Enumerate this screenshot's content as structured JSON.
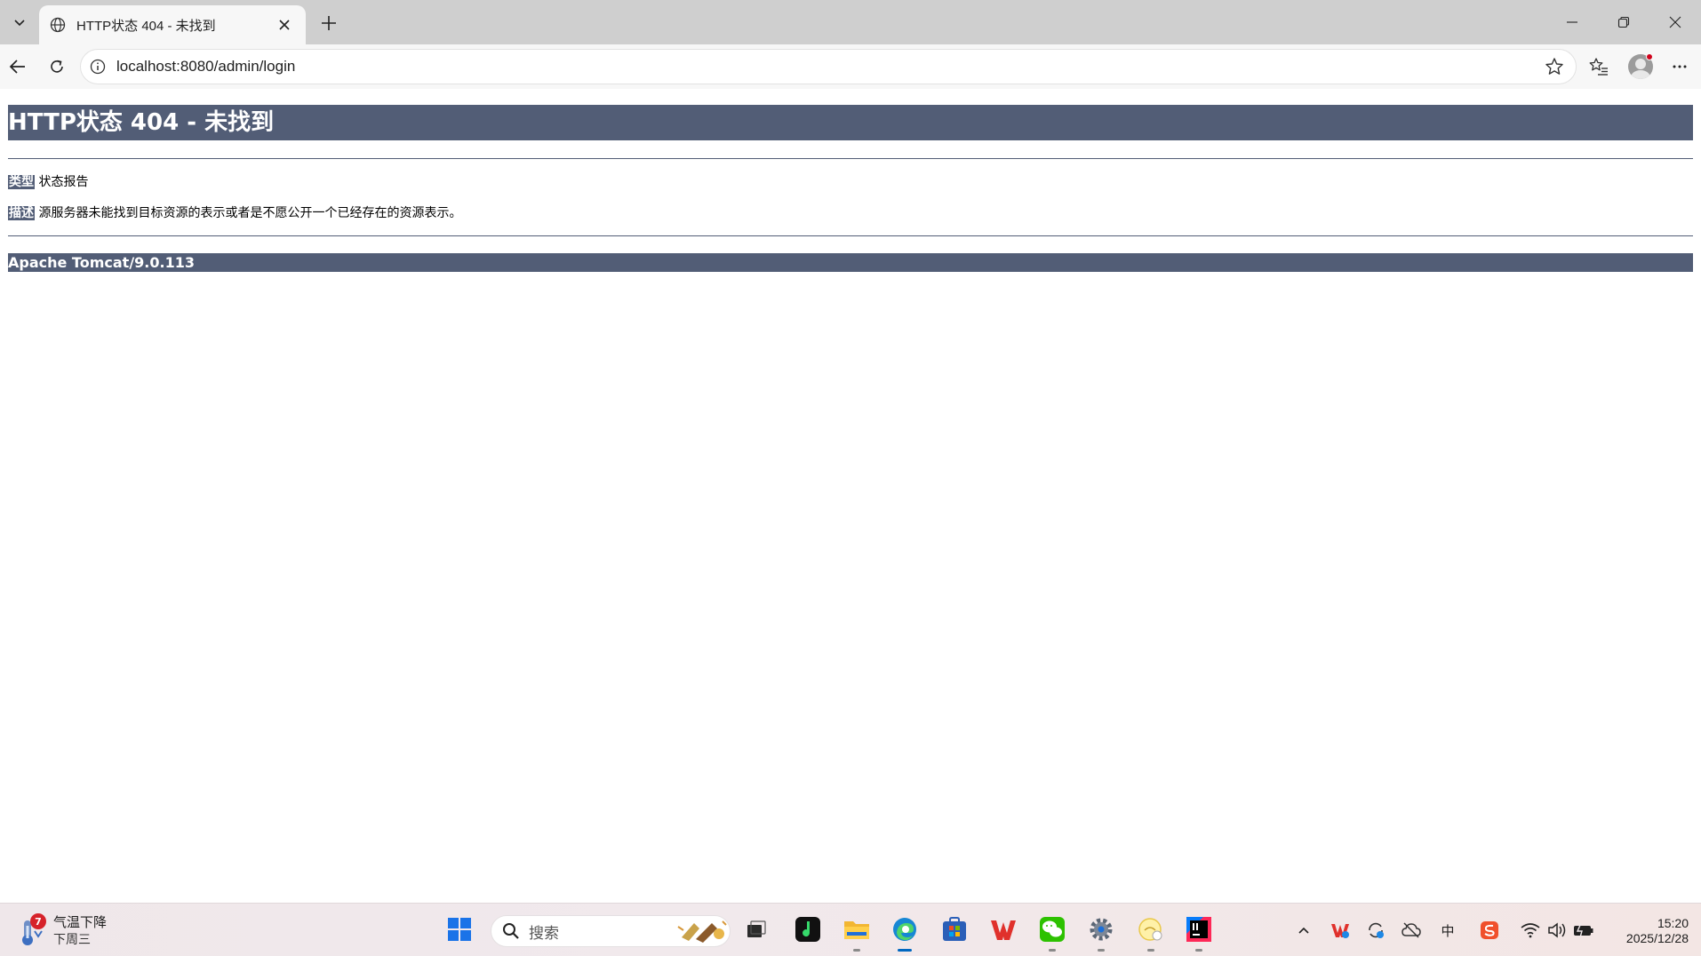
{
  "browser": {
    "tab_title": "HTTP状态 404 - 未找到",
    "url": "localhost:8080/admin/login"
  },
  "page": {
    "title": "HTTP状态 404 - 未找到",
    "type_label": "类型",
    "type_value": "状态报告",
    "desc_label": "描述",
    "desc_value": "源服务器未能找到目标资源的表示或者是不愿公开一个已经存在的资源表示。",
    "footer": "Apache Tomcat/9.0.113",
    "accent_color": "#525d76"
  },
  "taskbar": {
    "weather_badge": "7",
    "weather_line1": "气温下降",
    "weather_line2": "下周三",
    "search_placeholder": "搜索",
    "ime_label": "中",
    "time": "15:20",
    "date": "2025/12/28"
  }
}
